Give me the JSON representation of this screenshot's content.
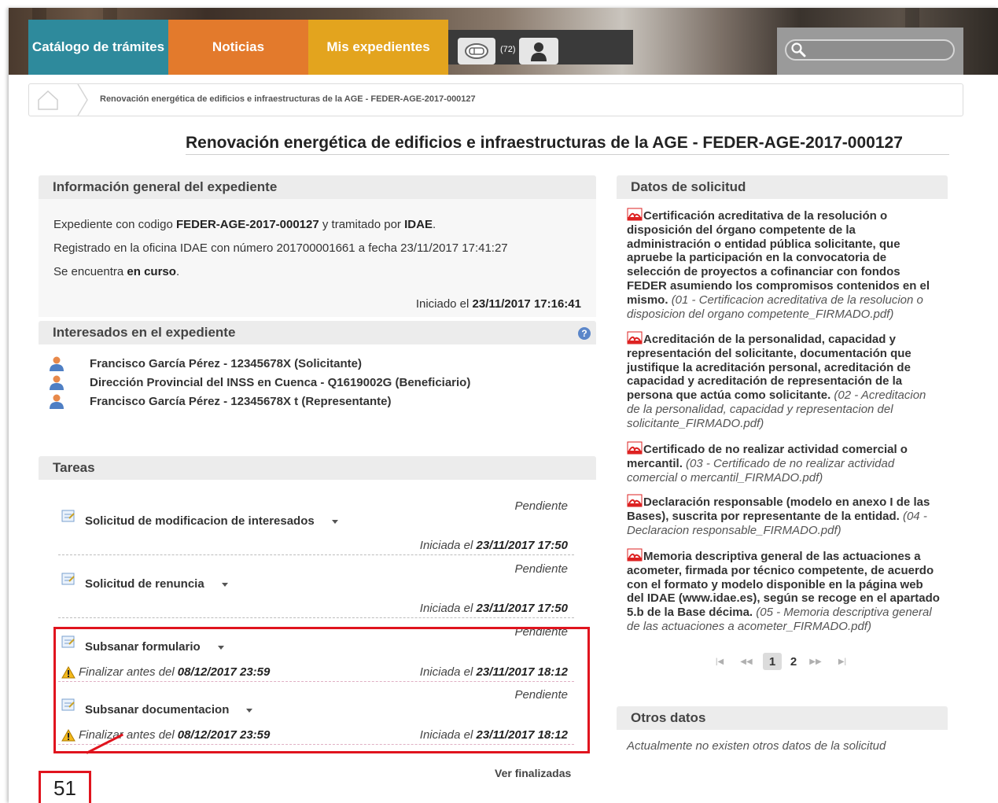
{
  "nav": {
    "tabs": [
      {
        "label": "Catálogo de trámites",
        "color": "#2e8a9c"
      },
      {
        "label": "Noticias",
        "color": "#e37a2c"
      },
      {
        "label": "Mis expedientes",
        "color": "#e3a41e"
      }
    ],
    "notification_count": "(72)",
    "search_placeholder": ""
  },
  "breadcrumb": {
    "current": "Renovación energética de edificios e infraestructuras de la AGE - FEDER-AGE-2017-000127"
  },
  "page_title": "Renovación energética de edificios e infraestructuras de la AGE - FEDER-AGE-2017-000127",
  "info_general": {
    "title": "Información general del expediente",
    "line1_prefix": "Expediente con codigo ",
    "line1_code": "FEDER-AGE-2017-000127",
    "line1_mid": " y tramitado por ",
    "line1_org": "IDAE",
    "line1_suffix": ".",
    "line2": "Registrado en la oficina IDAE con número 201700001661 a fecha 23/11/2017 17:41:27",
    "line3_prefix": "Se encuentra ",
    "line3_status": "en curso",
    "line3_suffix": ".",
    "started_prefix": "Iniciado el ",
    "started_date": "23/11/2017 17:16:41"
  },
  "interesados": {
    "title": "Interesados en el expediente",
    "items": [
      "Francisco García Pérez - 12345678X  (Solicitante)",
      "Dirección Provincial del INSS en Cuenca - Q1619002G (Beneficiario)",
      "Francisco García Pérez - 12345678X t (Representante)"
    ]
  },
  "tareas": {
    "title": "Tareas",
    "items": [
      {
        "name": "Solicitud de modificacion de interesados",
        "status": "Pendiente",
        "started_prefix": "Iniciada el ",
        "started_date": "23/11/2017 17:50",
        "deadline_prefix": "",
        "deadline_date": ""
      },
      {
        "name": "Solicitud de renuncia",
        "status": "Pendiente",
        "started_prefix": "Iniciada el ",
        "started_date": "23/11/2017 17:50",
        "deadline_prefix": "",
        "deadline_date": ""
      },
      {
        "name": "Subsanar formulario",
        "status": "Pendiente",
        "started_prefix": "Iniciada el ",
        "started_date": "23/11/2017 18:12",
        "deadline_prefix": "Finalizar antes del",
        "deadline_date": "08/12/2017 23:59"
      },
      {
        "name": "Subsanar documentacion",
        "status": "Pendiente",
        "started_prefix": "Iniciada el ",
        "started_date": "23/11/2017 18:12",
        "deadline_prefix": "Finalizar antes del",
        "deadline_date": "08/12/2017 23:59"
      }
    ],
    "ver_finalizadas": "Ver finalizadas",
    "annotation_badge": "51"
  },
  "datos_solicitud": {
    "title": "Datos de solicitud",
    "docs": [
      {
        "text": "Certificación acreditativa de la resolución o disposición del órgano competente de la administración o entidad pública solicitante, que apruebe la participación en la convocatoria de selección de proyectos a cofinanciar con fondos FEDER asumiendo los compromisos contenidos en el mismo.",
        "file": "(01 - Certificacion acreditativa de la resolucion o disposicion del organo competente_FIRMADO.pdf)"
      },
      {
        "text": "Acreditación de la personalidad, capacidad y representación del solicitante, documentación que justifique la acreditación personal, acreditación de capacidad y acreditación de representación de la persona que actúa como solicitante.",
        "file": "(02 - Acreditacion de la personalidad, capacidad y representacion del solicitante_FIRMADO.pdf)"
      },
      {
        "text": "Certificado de no realizar actividad comercial o mercantil.",
        "file": "(03 - Certificado de no realizar actividad comercial o mercantil_FIRMADO.pdf)"
      },
      {
        "text": "Declaración responsable (modelo en anexo I de las Bases), suscrita por representante de la entidad.",
        "file": "(04 - Declaracion responsable_FIRMADO.pdf)"
      },
      {
        "text": "Memoria descriptiva general de las actuaciones a acometer, firmada por técnico competente, de acuerdo con el formato y modelo disponible en la página web del IDAE (www.idae.es), según se recoge en el apartado 5.b de la Base décima.",
        "file": "(05 - Memoria descriptiva general de las actuaciones a acometer_FIRMADO.pdf)"
      }
    ],
    "pager": {
      "current": "1",
      "next": "2"
    }
  },
  "otros_datos": {
    "title": "Otros datos",
    "text": "Actualmente no existen otros datos de la solicitud"
  }
}
